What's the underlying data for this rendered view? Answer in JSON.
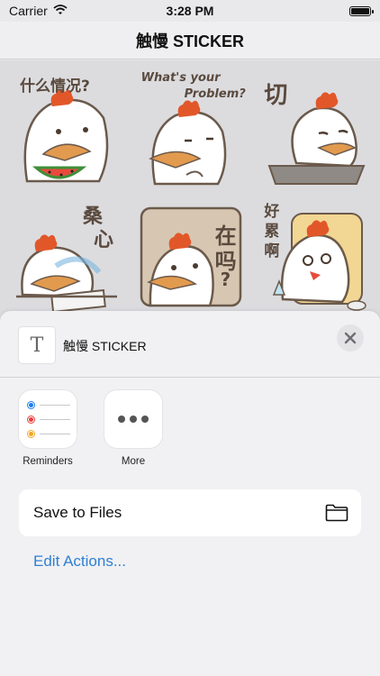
{
  "status_bar": {
    "carrier": "Carrier",
    "time": "3:28 PM",
    "icons": [
      "wifi-icon",
      "battery-icon"
    ]
  },
  "nav": {
    "title": "触慢 STICKER"
  },
  "stickers": [
    {
      "caption": "什么情况?",
      "icon": "chicken-eating-watermelon"
    },
    {
      "caption_line1": "What's your",
      "caption_line2": "Problem?",
      "icon": "chicken-shrugging"
    },
    {
      "caption": "切",
      "icon": "chicken-annoyed"
    },
    {
      "caption_line1": "桑",
      "caption_line2": "心",
      "icon": "chicken-sad-crying"
    },
    {
      "caption_line1": "在",
      "caption_line2": "吗",
      "caption_line3": "?",
      "icon": "chicken-in-frame"
    },
    {
      "caption_line1": "好",
      "caption_line2": "累",
      "caption_line3": "啊",
      "icon": "chicken-tired-on-couch"
    }
  ],
  "share_sheet": {
    "title": "触慢 STICKER",
    "thumbnail_glyph": "T",
    "apps": [
      {
        "label": "Reminders",
        "icon": "reminders-icon"
      },
      {
        "label": "More",
        "icon": "more-icon"
      }
    ],
    "actions": [
      {
        "label": "Save to Files",
        "icon": "folder-icon"
      }
    ],
    "edit_actions": "Edit Actions..."
  },
  "colors": {
    "accent": "#2f7fd3",
    "reminder_blue": "#1a7ff0",
    "reminder_red": "#e8413c",
    "reminder_orange": "#f5a623",
    "chicken_comb": "#e2572a",
    "chicken_beak": "#e29a4e"
  }
}
